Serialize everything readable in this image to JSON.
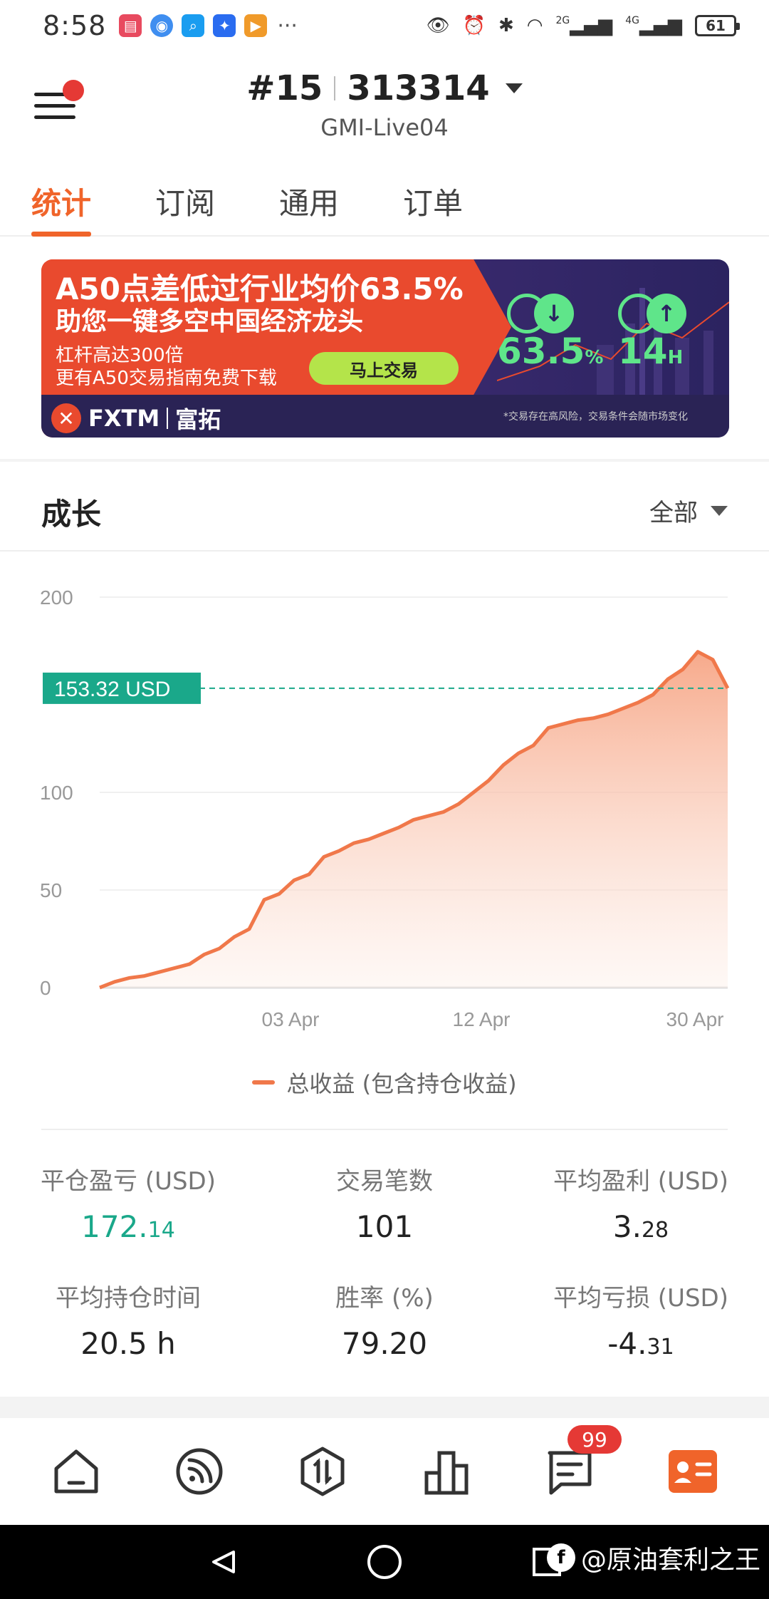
{
  "status_bar": {
    "time": "8:58",
    "more": "···",
    "network_labels": [
      "2G",
      "4G"
    ],
    "battery": "61"
  },
  "header": {
    "account_number": "#15",
    "account_id": "313314",
    "server": "GMI-Live04"
  },
  "tabs": [
    {
      "label": "统计",
      "active": true
    },
    {
      "label": "订阅",
      "active": false
    },
    {
      "label": "通用",
      "active": false
    },
    {
      "label": "订单",
      "active": false
    }
  ],
  "banner": {
    "headline": "A50点差低过行业均价63.5%",
    "subheadline": "助您一键多空中国经济龙头",
    "line1": "杠杆高达300倍",
    "line2": "更有A50交易指南免费下载",
    "cta": "马上交易",
    "stat1": "63.5",
    "stat1_unit": "%",
    "stat2": "14",
    "stat2_unit": "H",
    "brand": "FXTM",
    "brand_cn": "富拓",
    "disclaimer": "*交易存在高风险，交易条件会随市场变化"
  },
  "growth": {
    "title": "成长",
    "filter": "全部"
  },
  "chart_data": {
    "type": "area",
    "y_ticks": [
      "200",
      "100",
      "50",
      "0"
    ],
    "x_tick_labels": [
      "03 Apr",
      "12 Apr",
      "30 Apr"
    ],
    "ylim": [
      0,
      200
    ],
    "current_value_label": "153.32 USD",
    "current_value": 153.32,
    "series": [
      {
        "name": "总收益 (包含持仓收益)",
        "color": "#f0784a",
        "values": [
          0,
          3,
          5,
          6,
          8,
          10,
          12,
          17,
          20,
          26,
          30,
          45,
          48,
          55,
          58,
          67,
          70,
          74,
          76,
          79,
          82,
          86,
          88,
          90,
          94,
          100,
          106,
          114,
          120,
          124,
          133,
          135,
          137,
          138,
          140,
          143,
          146,
          150,
          158,
          163,
          172,
          168,
          153.32
        ]
      }
    ]
  },
  "legend": {
    "label": "总收益 (包含持仓收益)"
  },
  "stats": [
    {
      "label": "平仓盈亏 (USD)",
      "value_main": "172.",
      "value_sub": "14",
      "green": true
    },
    {
      "label": "交易笔数",
      "value_main": "101",
      "value_sub": "",
      "green": false
    },
    {
      "label": "平均盈利 (USD)",
      "value_main": "3.",
      "value_sub": "28",
      "green": false
    },
    {
      "label": "平均持仓时间",
      "value_main": "20.5 h",
      "value_sub": "",
      "green": false
    },
    {
      "label": "胜率 (%)",
      "value_main": "79.20",
      "value_sub": "",
      "green": false
    },
    {
      "label": "平均亏损 (USD)",
      "value_main": "-4.",
      "value_sub": "31",
      "green": false
    }
  ],
  "bottom_nav": {
    "badge": "99",
    "items": [
      "home-icon",
      "feed-icon",
      "trade-icon",
      "ranking-icon",
      "messages-icon",
      "profile-card-icon"
    ]
  },
  "watermark": "@原油套利之王",
  "colors": {
    "accent": "#f0642a",
    "green": "#1aa88a",
    "line": "#f0784a",
    "badge": "#e53935"
  }
}
